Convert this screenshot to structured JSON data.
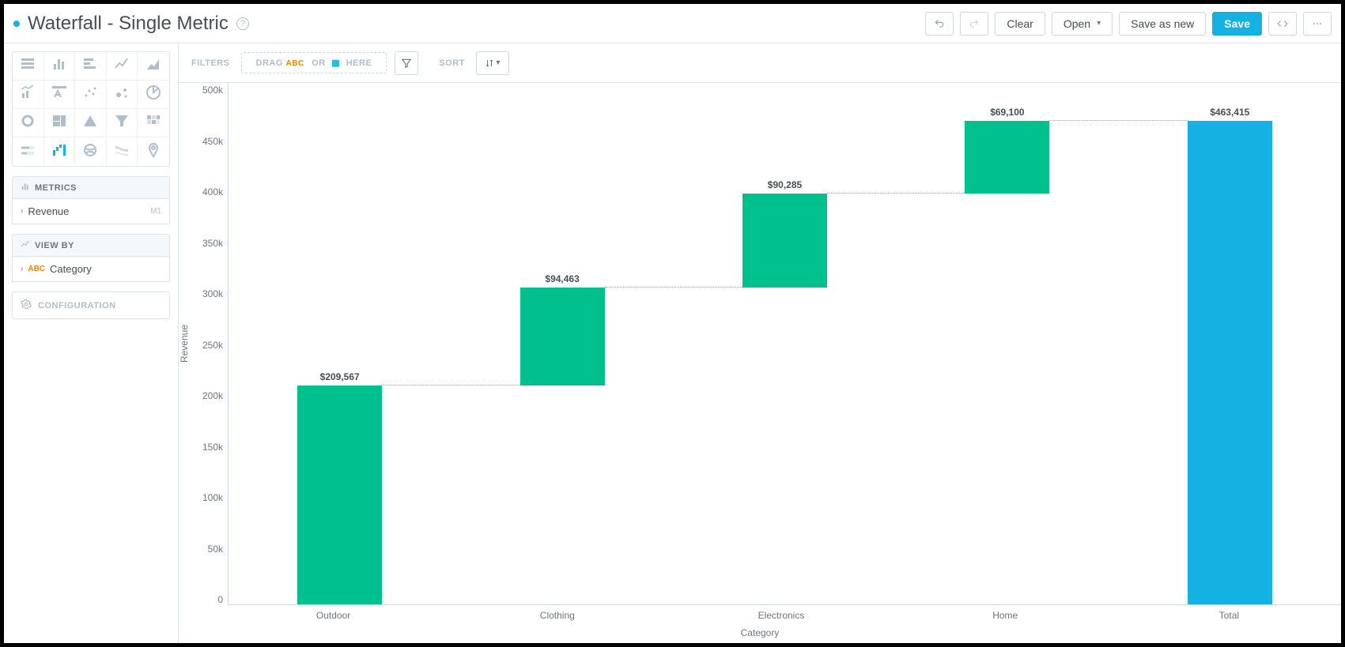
{
  "header": {
    "title": "Waterfall - Single Metric",
    "clear": "Clear",
    "open": "Open",
    "save_as_new": "Save as new",
    "save": "Save"
  },
  "sidebar": {
    "metrics_label": "METRICS",
    "metric_item": "Revenue",
    "metric_tag": "M1",
    "viewby_label": "VIEW BY",
    "viewby_item": "Category",
    "config_label": "CONFIGURATION"
  },
  "toolbar": {
    "filters_label": "FILTERS",
    "drag": "DRAG",
    "abc": "ABC",
    "or": "OR",
    "here": "HERE",
    "sort_label": "SORT"
  },
  "chart_data": {
    "type": "bar",
    "subtype": "waterfall",
    "ylabel": "Revenue",
    "xlabel": "Category",
    "ylim": [
      0,
      500000
    ],
    "yticks": [
      "500k",
      "450k",
      "400k",
      "350k",
      "300k",
      "250k",
      "200k",
      "150k",
      "100k",
      "50k",
      "0"
    ],
    "categories": [
      "Outdoor",
      "Clothing",
      "Electronics",
      "Home",
      "Total"
    ],
    "series": [
      {
        "name": "Outdoor",
        "value": 209567,
        "start": 0,
        "end": 209567,
        "label": "$209,567",
        "color": "#00c18d",
        "is_total": false
      },
      {
        "name": "Clothing",
        "value": 94463,
        "start": 209567,
        "end": 304030,
        "label": "$94,463",
        "color": "#00c18d",
        "is_total": false
      },
      {
        "name": "Electronics",
        "value": 90285,
        "start": 304030,
        "end": 394315,
        "label": "$90,285",
        "color": "#00c18d",
        "is_total": false
      },
      {
        "name": "Home",
        "value": 69100,
        "start": 394315,
        "end": 463415,
        "label": "$69,100",
        "color": "#00c18d",
        "is_total": false
      },
      {
        "name": "Total",
        "value": 463415,
        "start": 0,
        "end": 463415,
        "label": "$463,415",
        "color": "#14b2e2",
        "is_total": true
      }
    ]
  }
}
